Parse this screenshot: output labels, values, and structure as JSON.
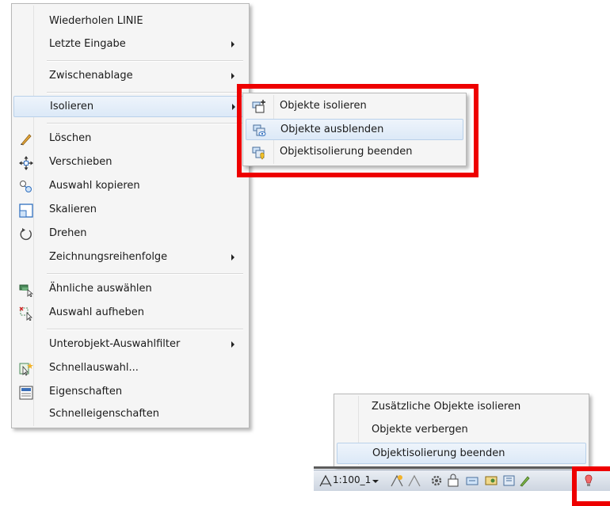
{
  "context_menu": {
    "items": [
      {
        "label": "Wiederholen LINIE",
        "icon": "",
        "submenu": false
      },
      {
        "label": "Letzte Eingabe",
        "icon": "",
        "submenu": true
      },
      {
        "label": "Zwischenablage",
        "icon": "",
        "submenu": true
      },
      {
        "label": "Isolieren",
        "icon": "",
        "submenu": true,
        "highlighted": true
      },
      {
        "label": "Löschen",
        "icon": "eraser-icon",
        "submenu": false
      },
      {
        "label": "Verschieben",
        "icon": "move-icon",
        "submenu": false
      },
      {
        "label": "Auswahl kopieren",
        "icon": "copy-selection-icon",
        "submenu": false
      },
      {
        "label": "Skalieren",
        "icon": "scale-icon",
        "submenu": false
      },
      {
        "label": "Drehen",
        "icon": "rotate-icon",
        "submenu": false
      },
      {
        "label": "Zeichnungsreihenfolge",
        "icon": "",
        "submenu": true
      },
      {
        "label": "Ähnliche auswählen",
        "icon": "select-similar-icon",
        "submenu": false
      },
      {
        "label": "Auswahl aufheben",
        "icon": "deselect-icon",
        "submenu": false
      },
      {
        "label": "Unterobjekt-Auswahlfilter",
        "icon": "",
        "submenu": true
      },
      {
        "label": "Schnellauswahl...",
        "icon": "quick-select-icon",
        "submenu": false
      },
      {
        "label": "Eigenschaften",
        "icon": "properties-icon",
        "submenu": false
      },
      {
        "label": "Schnelleigenschaften",
        "icon": "",
        "submenu": false
      }
    ]
  },
  "isolate_submenu": {
    "items": [
      {
        "label": "Objekte isolieren",
        "icon": "isolate-objects-icon"
      },
      {
        "label": "Objekte ausblenden",
        "icon": "hide-objects-icon",
        "highlighted": true
      },
      {
        "label": "Objektisolierung beenden",
        "icon": "end-isolation-icon"
      }
    ]
  },
  "status_popup": {
    "items": [
      {
        "label": "Zusätzliche Objekte isolieren"
      },
      {
        "label": "Objekte verbergen"
      },
      {
        "label": "Objektisolierung beenden",
        "highlighted": true
      }
    ]
  },
  "status_bar": {
    "annotation_scale": "1:100_1"
  },
  "colors": {
    "highlight_box": "#ee0000",
    "menu_hover": "#dce9f7"
  }
}
